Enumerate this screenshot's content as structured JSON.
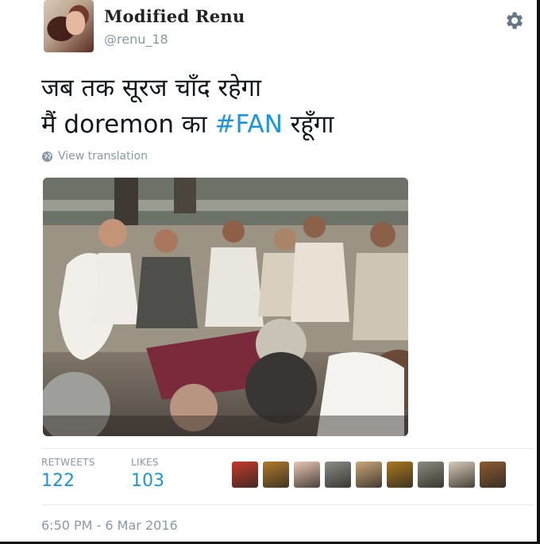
{
  "tweet": {
    "display_name": "Modified Renu",
    "username": "@renu_18",
    "text_line1": "जब तक सूरज चाँद रहेगा",
    "text_line2_pre": "मैं doremon का ",
    "hashtag": "#FAN",
    "text_line2_post": " रहूँगा",
    "view_translation": "View translation",
    "timestamp": "6:50 PM - 6 Mar 2016"
  },
  "stats": {
    "retweets_label": "RETWEETS",
    "retweets_value": "122",
    "likes_label": "LIKES",
    "likes_value": "103"
  },
  "likers": [
    {
      "name": "liker-avatar-1",
      "color": "#c43a2c"
    },
    {
      "name": "liker-avatar-2",
      "color": "#b07a2a"
    },
    {
      "name": "liker-avatar-3",
      "color": "#e9c7b4"
    },
    {
      "name": "liker-avatar-4",
      "color": "#8a8d87"
    },
    {
      "name": "liker-avatar-5",
      "color": "#c9a67a"
    },
    {
      "name": "liker-avatar-6",
      "color": "#a8781e"
    },
    {
      "name": "liker-avatar-7",
      "color": "#8c8a7e"
    },
    {
      "name": "liker-avatar-8",
      "color": "#d8cbb9"
    },
    {
      "name": "liker-avatar-9",
      "color": "#8a5a30"
    }
  ],
  "colors": {
    "link": "#1b95e0",
    "muted": "#8899a6",
    "text": "#14171a"
  },
  "icons": {
    "settings": "gear-icon",
    "translate": "globe-icon"
  }
}
